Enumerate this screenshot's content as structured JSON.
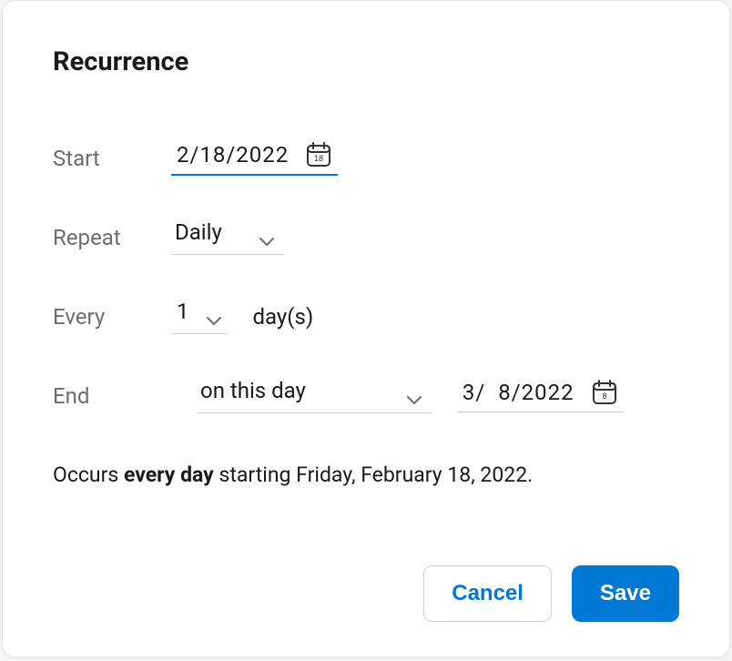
{
  "dialog": {
    "title": "Recurrence"
  },
  "form": {
    "start_label": "Start",
    "start_date": "2/18/2022",
    "start_icon_day": "18",
    "repeat_label": "Repeat",
    "repeat_value": "Daily",
    "every_label": "Every",
    "every_value": "1",
    "every_unit": "day(s)",
    "end_label": "End",
    "end_mode": "on this day",
    "end_date": "3/  8/2022",
    "end_icon_day": "8"
  },
  "summary": {
    "prefix": "Occurs ",
    "bold": "every day",
    "suffix": " starting Friday, February 18, 2022."
  },
  "buttons": {
    "cancel": "Cancel",
    "save": "Save"
  }
}
